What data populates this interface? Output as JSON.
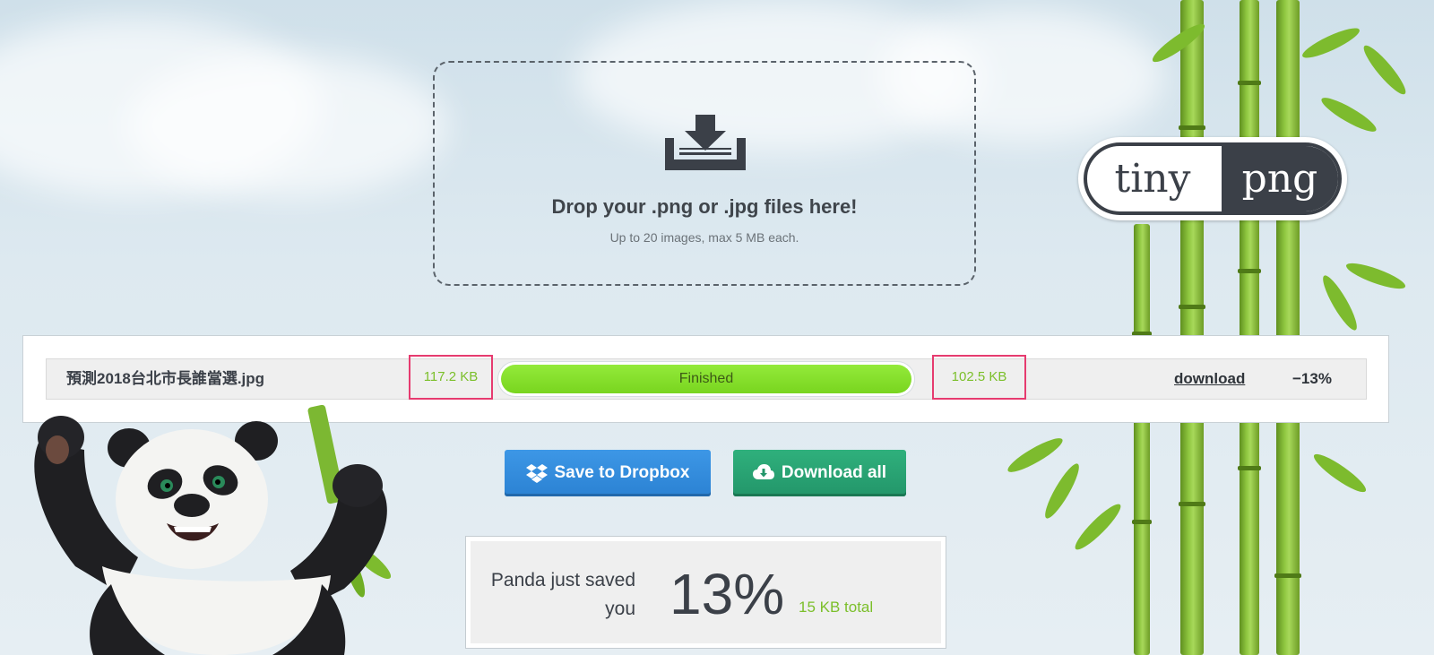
{
  "dropzone": {
    "title": "Drop your .png or .jpg files here!",
    "subtitle": "Up to 20 images, max 5 MB each."
  },
  "logo": {
    "left_text": "tiny",
    "right_text": "png"
  },
  "file": {
    "name": "預測2018台北市長誰當選.jpg",
    "original_size": "117.2 KB",
    "status": "Finished",
    "progress": 1.0,
    "compressed_size": "102.5 KB",
    "download_label": "download",
    "savings": "−13%"
  },
  "buttons": {
    "dropbox_label": "Save to Dropbox",
    "download_all_label": "Download all"
  },
  "summary": {
    "label": "Panda just saved you",
    "percent": "13%",
    "total": "15 KB total"
  },
  "colors": {
    "accent_green": "#7bbf2a",
    "highlight_pink": "#e63b6f",
    "dropbox_blue": "#2b82d3",
    "download_green": "#23966a",
    "text_dark": "#3b4048"
  },
  "icons": {
    "dropzone": "download-tray-icon",
    "dropbox": "dropbox-icon",
    "download_all": "cloud-download-icon"
  }
}
